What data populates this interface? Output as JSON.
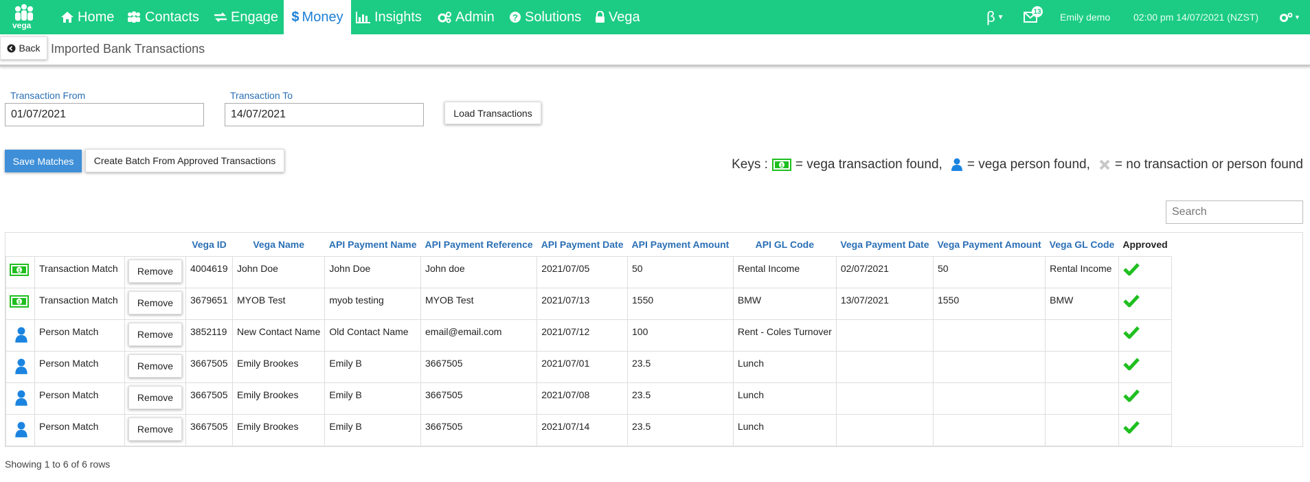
{
  "nav": {
    "logo_text": "vega",
    "items": [
      {
        "label": "Home",
        "icon": "home-icon"
      },
      {
        "label": "Contacts",
        "icon": "contacts-icon"
      },
      {
        "label": "Engage",
        "icon": "exchange-icon"
      },
      {
        "label": "Money",
        "icon": "dollar-icon",
        "active": true
      },
      {
        "label": "Insights",
        "icon": "bar-chart-icon"
      },
      {
        "label": "Admin",
        "icon": "cogs-icon"
      },
      {
        "label": "Solutions",
        "icon": "question-icon"
      },
      {
        "label": "Vega",
        "icon": "lock-icon"
      }
    ],
    "beta_label": "β",
    "mail_count": "13",
    "user_name": "Emily demo",
    "datetime": "02:00 pm 14/07/2021 (NZST)"
  },
  "header": {
    "back_label": "Back",
    "title": "Imported Bank Transactions"
  },
  "filters": {
    "from_label": "Transaction From",
    "from_value": "01/07/2021",
    "to_label": "Transaction To",
    "to_value": "14/07/2021",
    "load_label": "Load Transactions"
  },
  "actions": {
    "save_label": "Save Matches",
    "batch_label": "Create Batch From Approved Transactions"
  },
  "keys": {
    "prefix": "Keys :",
    "transaction": "= vega transaction found,",
    "person": "= vega person found,",
    "none": "= no transaction or person found"
  },
  "search": {
    "placeholder": "Search"
  },
  "table": {
    "columns": [
      "Vega ID",
      "Vega Name",
      "API Payment Name",
      "API Payment Reference",
      "API Payment Date",
      "API Payment Amount",
      "API GL Code",
      "Vega Payment Date",
      "Vega Payment Amount",
      "Vega GL Code",
      "Approved"
    ],
    "remove_label": "Remove",
    "rows": [
      {
        "type": "money",
        "match": "Transaction Match",
        "vega_id": "4004619",
        "vega_name": "John Doe",
        "api_name": "John Doe",
        "api_ref": "John doe",
        "api_date": "2021/07/05",
        "api_amount": "50",
        "api_gl": "Rental Income",
        "vega_date": "02/07/2021",
        "vega_amount": "50",
        "vega_gl": "Rental Income"
      },
      {
        "type": "money",
        "match": "Transaction Match",
        "vega_id": "3679651",
        "vega_name": "MYOB Test",
        "api_name": "myob testing",
        "api_ref": "MYOB Test",
        "api_date": "2021/07/13",
        "api_amount": "1550",
        "api_gl": "BMW",
        "vega_date": "13/07/2021",
        "vega_amount": "1550",
        "vega_gl": "BMW"
      },
      {
        "type": "person",
        "match": "Person Match",
        "vega_id": "3852119",
        "vega_name": "New Contact Name",
        "api_name": "Old Contact Name",
        "api_ref": "email@email.com",
        "api_date": "2021/07/12",
        "api_amount": "100",
        "api_gl": "Rent - Coles Turnover",
        "vega_date": "",
        "vega_amount": "",
        "vega_gl": ""
      },
      {
        "type": "person",
        "match": "Person Match",
        "vega_id": "3667505",
        "vega_name": "Emily Brookes",
        "api_name": "Emily B",
        "api_ref": "3667505",
        "api_date": "2021/07/01",
        "api_amount": "23.5",
        "api_gl": "Lunch",
        "vega_date": "",
        "vega_amount": "",
        "vega_gl": ""
      },
      {
        "type": "person",
        "match": "Person Match",
        "vega_id": "3667505",
        "vega_name": "Emily Brookes",
        "api_name": "Emily B",
        "api_ref": "3667505",
        "api_date": "2021/07/08",
        "api_amount": "23.5",
        "api_gl": "Lunch",
        "vega_date": "",
        "vega_amount": "",
        "vega_gl": ""
      },
      {
        "type": "person",
        "match": "Person Match",
        "vega_id": "3667505",
        "vega_name": "Emily Brookes",
        "api_name": "Emily B",
        "api_ref": "3667505",
        "api_date": "2021/07/14",
        "api_amount": "23.5",
        "api_gl": "Lunch",
        "vega_date": "",
        "vega_amount": "",
        "vega_gl": ""
      }
    ]
  },
  "footer": {
    "rows_text": "Showing 1 to 6 of 6 rows"
  },
  "colors": {
    "brand": "#1ccc84",
    "link": "#2a6fb5",
    "primary": "#3e8fd8",
    "check": "#1fbf1f",
    "person": "#1b84e0"
  }
}
